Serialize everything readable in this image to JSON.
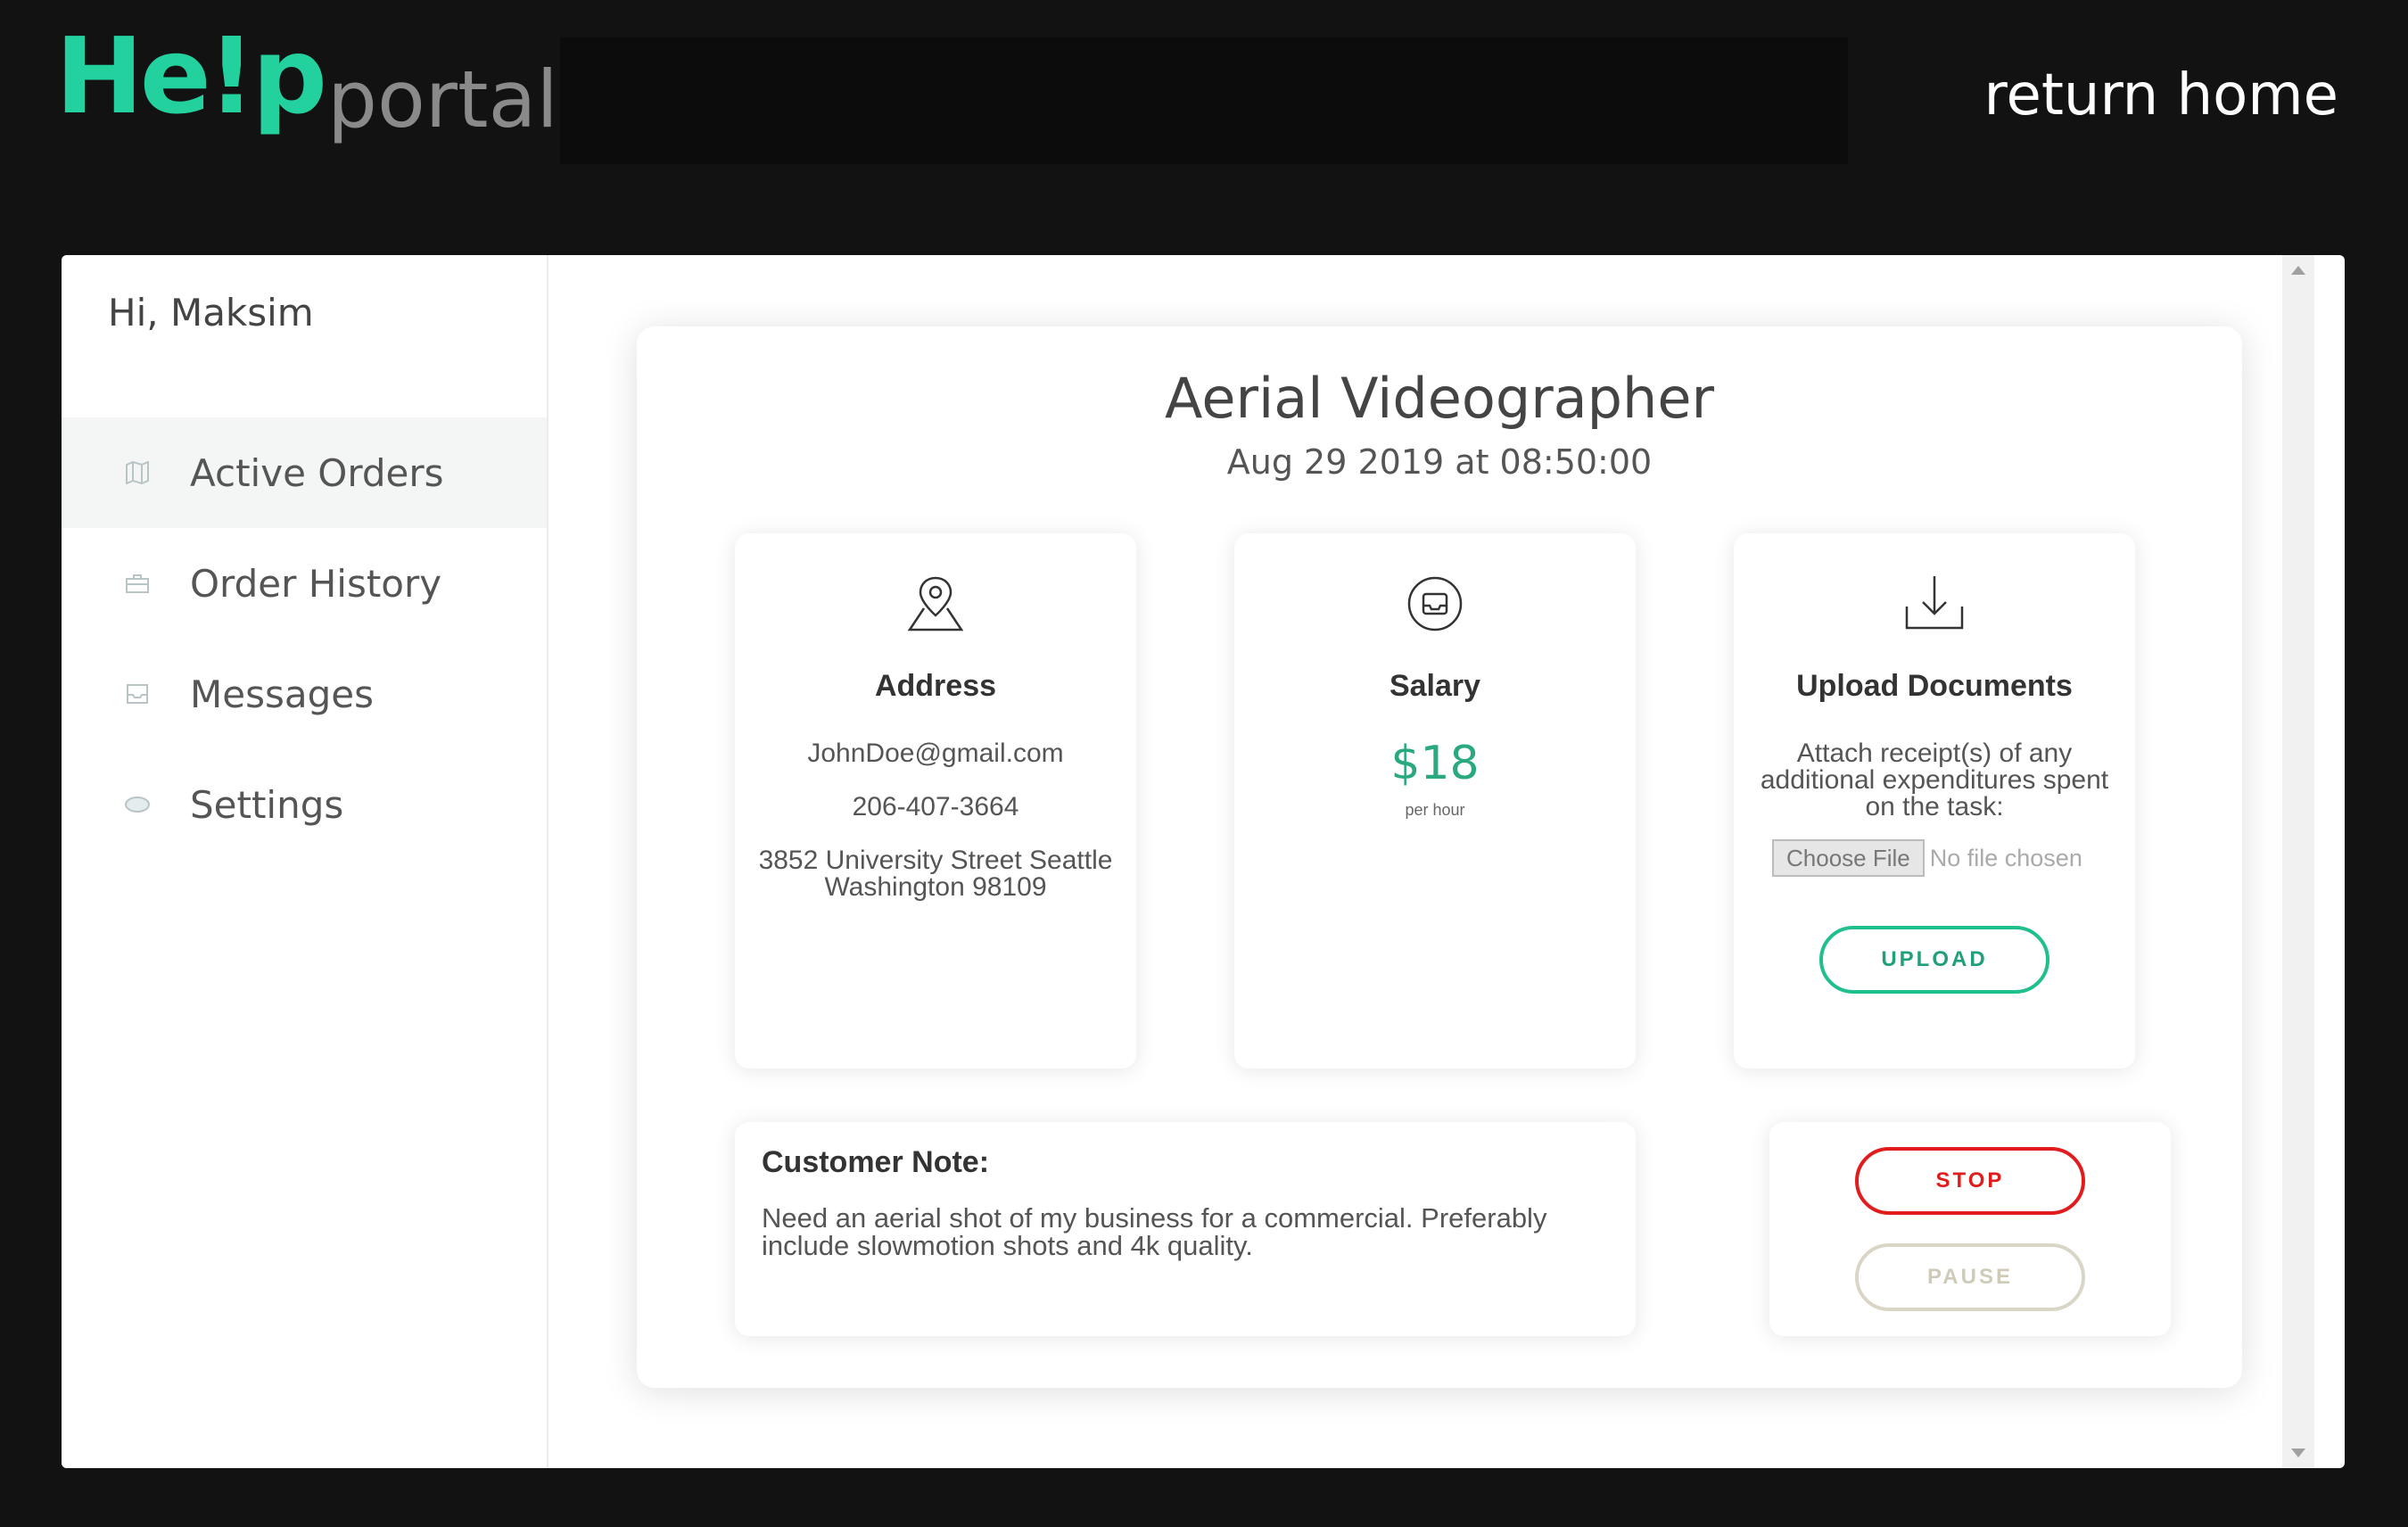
{
  "header": {
    "logo_help": "He!p",
    "logo_portal": "portal",
    "return_home": "return home"
  },
  "sidebar": {
    "greeting": "Hi, Maksim",
    "items": [
      {
        "label": "Active Orders",
        "icon": "map-icon",
        "active": true
      },
      {
        "label": "Order History",
        "icon": "briefcase-icon",
        "active": false
      },
      {
        "label": "Messages",
        "icon": "inbox-icon",
        "active": false
      },
      {
        "label": "Settings",
        "icon": "eye-icon",
        "active": false
      }
    ]
  },
  "order": {
    "title": "Aerial Videographer",
    "date": "Aug 29 2019 at 08:50:00",
    "address": {
      "icon": "map-pin-icon",
      "title": "Address",
      "email": "JohnDoe@gmail.com",
      "phone": "206-407-3664",
      "street": "3852 University Street Seattle Washington 98109"
    },
    "salary": {
      "icon": "inbox-circle-icon",
      "title": "Salary",
      "amount": "$18",
      "unit": "per hour"
    },
    "upload": {
      "icon": "download-icon",
      "title": "Upload Documents",
      "description": "Attach receipt(s) of any additional expenditures spent on the task:",
      "choose_file": "Choose File",
      "no_file": "No file chosen",
      "button": "UPLOAD"
    },
    "note": {
      "title": "Customer Note:",
      "text": "Need an aerial shot of my business for a commercial. Preferably include slowmotion shots and 4k quality."
    },
    "controls": {
      "stop": "STOP",
      "pause": "PAUSE"
    }
  },
  "colors": {
    "brand": "#23d19f",
    "stop": "#e01c1c",
    "pause": "#d9d6c6",
    "salary": "#2aa880"
  }
}
